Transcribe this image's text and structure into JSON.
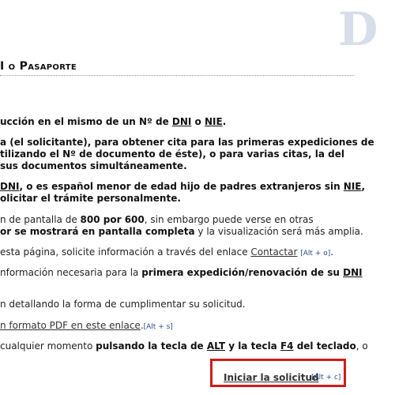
{
  "header": {
    "logo_text": "D",
    "title": "I o Pasaporte"
  },
  "paragraphs": {
    "p1": {
      "a": "ucción en el mismo de un Nº de ",
      "dni": "DNI",
      "b": " o ",
      "nie": "NIE",
      "c": "."
    },
    "p2_l1": "a (el solicitante), para obtener cita para las primeras expediciones de",
    "p2_l2": "tilizando el Nº de documento de éste), o para varias citas, la del",
    "p2_l3": "sus documentos simultáneamente.",
    "p3_l1": {
      "dni": "DNI",
      "a": ", o es español menor de edad hijo de padres extranjeros sin ",
      "nie": "NIE",
      "b": ","
    },
    "p3_l2": "olicitar el trámite personalmente.",
    "p4_l1": {
      "a": "n de pantalla de ",
      "res": "800 por 600",
      "b": ", sin embargo puede verse en otras"
    },
    "p4_l2": {
      "a": "or se mostrará en pantalla completa",
      "b": " y la visualización será más amplia."
    },
    "p5": {
      "a": "esta página, solicite información a través del enlace ",
      "link": "Contactar",
      "shortcut": "[Alt + o]",
      "b": "."
    },
    "p6": {
      "a": "nformación necesaria para la ",
      "b": "primera expedición/renovación de su ",
      "dni": "DNI"
    },
    "p7": "n detallando la forma de cumplimentar su solicitud.",
    "p8": {
      "link": "n formato PDF en este enlace",
      "b": ".",
      "shortcut": "[Alt + s]"
    },
    "p9": {
      "a": "cualquier momento ",
      "b": "pulsando la tecla de ",
      "alt": "ALT",
      "c": " y la tecla ",
      "f4": "F4",
      "d": " del teclado",
      "e": ", o"
    }
  },
  "cta": {
    "label": "Iniciar la solicitud",
    "shortcut": "[Alt + c]"
  },
  "colors": {
    "highlight_border": "#d01c1c",
    "shortcut_text": "#2a4d8a"
  }
}
